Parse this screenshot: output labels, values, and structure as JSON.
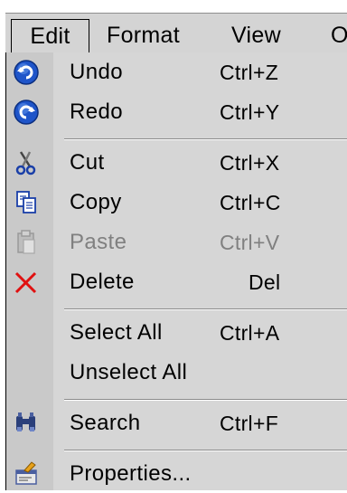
{
  "menubar": {
    "items": [
      {
        "label": "Edit",
        "active": true
      },
      {
        "label": "Format"
      },
      {
        "label": "View"
      },
      {
        "label": "O"
      }
    ]
  },
  "menu": {
    "items": [
      {
        "label": "Undo",
        "shortcut": "Ctrl+Z",
        "icon": "undo-icon"
      },
      {
        "label": "Redo",
        "shortcut": "Ctrl+Y",
        "icon": "redo-icon"
      },
      {
        "label": "Cut",
        "shortcut": "Ctrl+X",
        "icon": "scissors-icon"
      },
      {
        "label": "Copy",
        "shortcut": "Ctrl+C",
        "icon": "copy-icon"
      },
      {
        "label": "Paste",
        "shortcut": "Ctrl+V",
        "icon": "paste-icon",
        "disabled": true
      },
      {
        "label": "Delete",
        "shortcut": "Del",
        "icon": "delete-icon"
      },
      {
        "label": "Select All",
        "shortcut": "Ctrl+A"
      },
      {
        "label": "Unselect All"
      },
      {
        "label": "Search",
        "shortcut": "Ctrl+F",
        "icon": "binoculars-icon"
      },
      {
        "label": "Properties...",
        "icon": "properties-icon"
      }
    ]
  },
  "colors": {
    "menu_bg": "#d6d6d6",
    "icon_column": "#c9c9c9",
    "disabled_text": "#808080",
    "undo_redo_blue": "#1f55c9",
    "delete_red": "#e01010"
  }
}
